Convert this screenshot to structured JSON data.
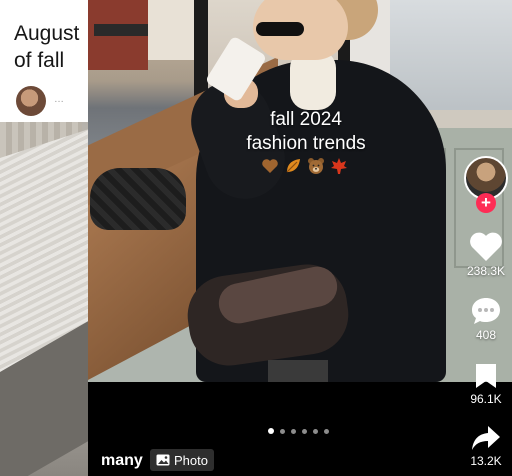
{
  "left_card": {
    "title": "August\nof fall",
    "ellipsis": "…"
  },
  "video": {
    "caption_line1": "fall 2024",
    "caption_line2": "fashion trends",
    "emojis": [
      "brown-heart-icon",
      "leaf-icon",
      "bear-icon",
      "maple-leaf-icon"
    ],
    "author": "many",
    "post_type": "Photo",
    "carousel": {
      "total": 6,
      "active": 0
    }
  },
  "actions": {
    "follow_label": "+",
    "likes": "238.3K",
    "comments": "408",
    "saves": "96.1K",
    "shares": "13.2K"
  },
  "colors": {
    "follow": "#fe2c55",
    "background": "#000000"
  }
}
